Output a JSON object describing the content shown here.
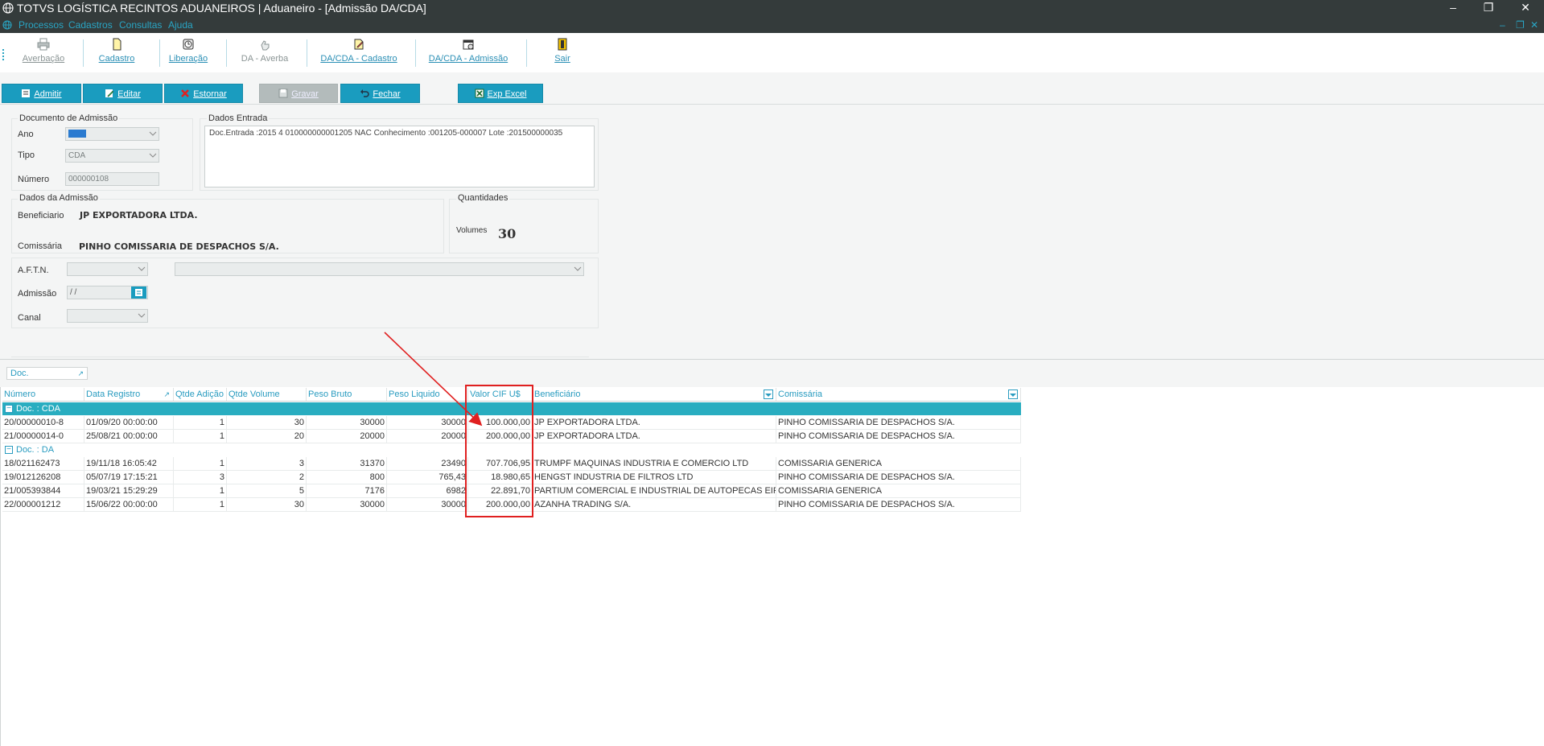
{
  "window": {
    "title": "TOTVS LOGÍSTICA RECINTOS ADUANEIROS | Aduaneiro - [Admissão DA/CDA]"
  },
  "menu": [
    "Processos",
    "Cadastros",
    "Consultas",
    "Ajuda"
  ],
  "toolbar": {
    "items": [
      {
        "label": "Averbação",
        "icon": "printer-icon",
        "enabled": false
      },
      {
        "label": "Cadastro",
        "icon": "document-icon",
        "enabled": true
      },
      {
        "label": "Liberação",
        "icon": "clock-icon",
        "enabled": true
      },
      {
        "label": "DA - Averba",
        "icon": "hand-icon",
        "enabled": false
      },
      {
        "label": "DA/CDA - Cadastro",
        "icon": "edit-document-icon",
        "enabled": true
      },
      {
        "label": "DA/CDA - Admissão",
        "icon": "calendar-icon",
        "enabled": true
      },
      {
        "label": "Sair",
        "icon": "exit-door-icon",
        "enabled": true
      }
    ]
  },
  "actions": {
    "admitir": "Admitir",
    "editar": "Editar",
    "estornar": "Estornar",
    "gravar": "Gravar",
    "fechar": "Fechar",
    "exp_excel": "Exp Excel"
  },
  "documento": {
    "group_label": "Documento de Admissão",
    "ano_label": "Ano",
    "ano_value": "2022",
    "tipo_label": "Tipo",
    "tipo_value": "CDA",
    "numero_label": "Número",
    "numero_value": "000000108"
  },
  "dados_entrada": {
    "group_label": "Dados  Entrada",
    "text": "Doc.Entrada :2015 4 010000000001205 NAC Conhecimento :001205-000007 Lote :201500000035"
  },
  "dados_admissao": {
    "group_label": "Dados da Admissão",
    "beneficiario_label": "Beneficiario",
    "beneficiario_value": "JP EXPORTADORA LTDA.",
    "comissaria_label": "Comissária",
    "comissaria_value": "PINHO COMISSARIA DE DESPACHOS S/A."
  },
  "quantidades": {
    "group_label": "Quantidades",
    "volumes_label": "Volumes",
    "volumes_value": "30"
  },
  "extra": {
    "aftn_label": "A.F.T.N.",
    "admissao_label": "Admissão",
    "admissao_value": " /  /",
    "canal_label": "Canal"
  },
  "grid": {
    "group_by": "Doc.",
    "columns": [
      "Número",
      "Data Registro",
      "Qtde Adição",
      "Qtde Volume",
      "Peso Bruto",
      "Peso Liquido",
      "Valor CIF U$",
      "Beneficiário",
      "Comissária"
    ],
    "groups": [
      {
        "label": "Doc. : CDA",
        "rows": [
          [
            "20/00000010-8",
            "01/09/20 00:00:00",
            "1",
            "30",
            "30000",
            "30000",
            "100.000,00",
            "JP EXPORTADORA LTDA.",
            "PINHO COMISSARIA DE DESPACHOS S/A."
          ],
          [
            "21/00000014-0",
            "25/08/21 00:00:00",
            "1",
            "20",
            "20000",
            "20000",
            "200.000,00",
            "JP EXPORTADORA LTDA.",
            "PINHO COMISSARIA DE DESPACHOS S/A."
          ]
        ]
      },
      {
        "label": "Doc. : DA",
        "rows": [
          [
            "18/021162473",
            "19/11/18 16:05:42",
            "1",
            "3",
            "31370",
            "23490",
            "707.706,95",
            "TRUMPF MAQUINAS INDUSTRIA E COMERCIO LTD",
            "COMISSARIA GENERICA"
          ],
          [
            "19/012126208",
            "05/07/19 17:15:21",
            "3",
            "2",
            "800",
            "765,43",
            "18.980,65",
            "HENGST INDUSTRIA DE FILTROS LTD",
            "PINHO COMISSARIA DE DESPACHOS S/A."
          ],
          [
            "21/005393844",
            "19/03/21 15:29:29",
            "1",
            "5",
            "7176",
            "6982",
            "22.891,70",
            "PARTIUM COMERCIAL E INDUSTRIAL DE AUTOPECAS EIF",
            "COMISSARIA GENERICA"
          ],
          [
            "22/000001212",
            "15/06/22 00:00:00",
            "1",
            "30",
            "30000",
            "30000",
            "200.000,00",
            "AZANHA TRADING S/A.",
            "PINHO COMISSARIA DE DESPACHOS S/A."
          ]
        ]
      }
    ]
  },
  "colors": {
    "accent": "#1a9cbf",
    "titlebar": "#343b3b",
    "annotation": "#e02020"
  }
}
